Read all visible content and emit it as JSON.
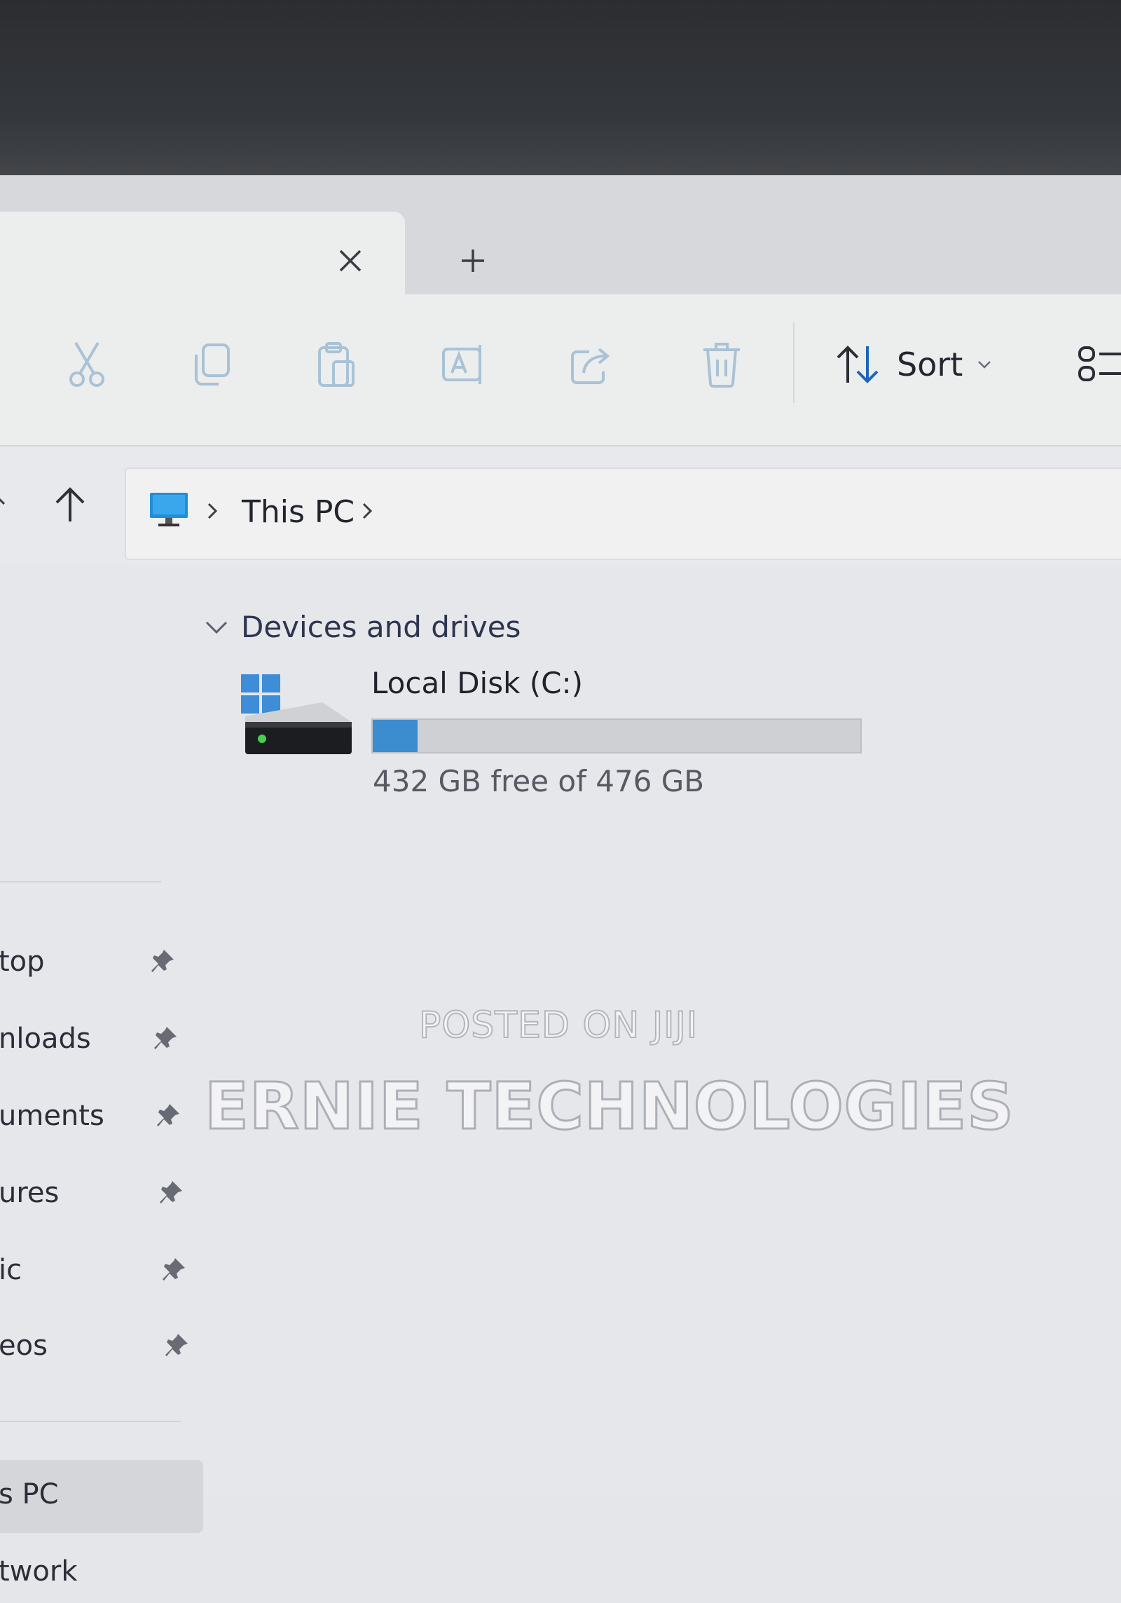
{
  "tabs": {
    "close_icon": "close-icon",
    "new_tab_icon": "plus-icon"
  },
  "toolbar": {
    "sort_label": "Sort",
    "icons": [
      "cut-icon",
      "copy-icon",
      "paste-icon",
      "rename-icon",
      "share-icon",
      "delete-icon"
    ]
  },
  "address": {
    "crumb": "This PC"
  },
  "sidebar": {
    "items": [
      {
        "label": "top",
        "pinned": true
      },
      {
        "label": "nloads",
        "pinned": true
      },
      {
        "label": "uments",
        "pinned": true
      },
      {
        "label": "ures",
        "pinned": true
      },
      {
        "label": "ic",
        "pinned": true
      },
      {
        "label": "eos",
        "pinned": true
      }
    ],
    "this_pc": "s PC",
    "network": "twork"
  },
  "content": {
    "section_title": "Devices and drives",
    "drives": [
      {
        "name": "Local Disk (C:)",
        "info": "432 GB free of 476 GB",
        "used_fraction": 0.092
      }
    ]
  },
  "watermark": {
    "line1": "POSTED ON JIJI",
    "line2": "ERNIE TECHNOLOGIES"
  },
  "colors": {
    "accent": "#3c8cd0",
    "window_bg": "#e6e7ea"
  }
}
